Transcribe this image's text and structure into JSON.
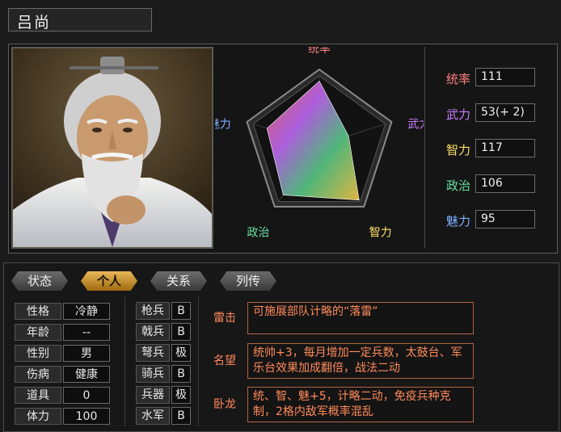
{
  "general": {
    "name": "吕尚"
  },
  "radar": {
    "labels": [
      "统率",
      "武力",
      "智力",
      "政治",
      "魅力"
    ],
    "label_colors": [
      "#ff8080",
      "#c87dff",
      "#ffe066",
      "#66e0a0",
      "#7fb0ff"
    ],
    "values": [
      111,
      53,
      117,
      106,
      95
    ]
  },
  "stats": [
    {
      "label": "统率",
      "value": "111",
      "color": "#ff8080"
    },
    {
      "label": "武力",
      "value": "53(+ 2)",
      "color": "#c87dff"
    },
    {
      "label": "智力",
      "value": "117",
      "color": "#ffe066"
    },
    {
      "label": "政治",
      "value": "106",
      "color": "#66e0a0"
    },
    {
      "label": "魅力",
      "value": "95",
      "color": "#7fb0ff"
    }
  ],
  "tabs": [
    "状态",
    "个人",
    "关系",
    "列传"
  ],
  "active_tab": "个人",
  "info": [
    {
      "label": "性格",
      "value": "冷静"
    },
    {
      "label": "年龄",
      "value": "--"
    },
    {
      "label": "性别",
      "value": "男"
    },
    {
      "label": "伤病",
      "value": "健康"
    },
    {
      "label": "道具",
      "value": "0"
    },
    {
      "label": "体力",
      "value": "100"
    }
  ],
  "aptitudes": [
    {
      "label": "枪兵",
      "value": "B"
    },
    {
      "label": "戟兵",
      "value": "B"
    },
    {
      "label": "弩兵",
      "value": "极"
    },
    {
      "label": "骑兵",
      "value": "B"
    },
    {
      "label": "兵器",
      "value": "极"
    },
    {
      "label": "水军",
      "value": "B"
    }
  ],
  "skills": [
    {
      "name": "雷击",
      "desc": "可施展部队计略的“落雷”"
    },
    {
      "name": "名望",
      "desc": "统帅+3，每月增加一定兵数，太鼓台、军乐台效果加成翻倍，战法二动"
    },
    {
      "name": "卧龙",
      "desc": "统、智、魅+5，计略二动，免疫兵种克制，2格内敌军概率混乱"
    }
  ]
}
